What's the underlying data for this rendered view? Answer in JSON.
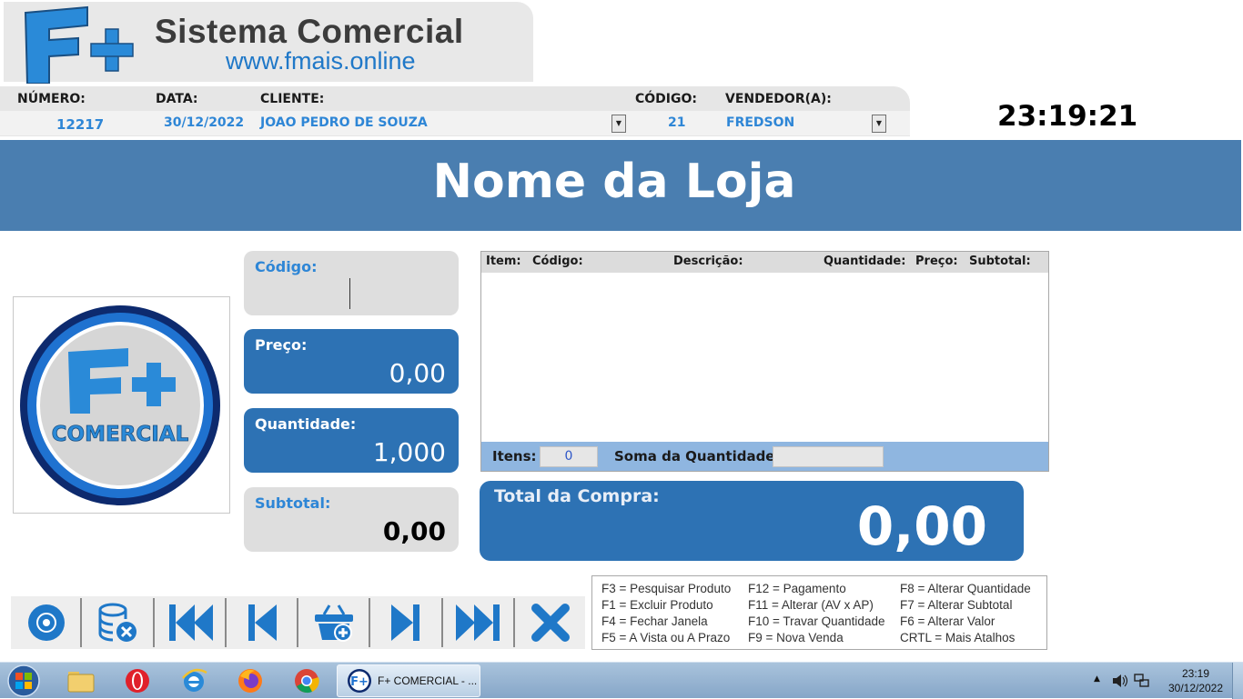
{
  "logo": {
    "title": "Sistema Comercial",
    "url": "www.fmais.online"
  },
  "header": {
    "numero_label": "NÚMERO:",
    "numero_value": "12217",
    "data_label": "DATA:",
    "data_value": "30/12/2022",
    "cliente_label": "CLIENTE:",
    "cliente_value": "JOAO PEDRO DE SOUZA",
    "codigo_label": "CÓDIGO:",
    "codigo_value": "21",
    "vendedor_label": "VENDEDOR(A):",
    "vendedor_value": "FREDSON",
    "clock": "23:19:21"
  },
  "banner": {
    "store_name": "Nome da Loja"
  },
  "circle_logo": {
    "text": "COMERCIAL"
  },
  "fields": {
    "codigo_label": "Código:",
    "codigo_value": "",
    "preco_label": "Preço:",
    "preco_value": "0,00",
    "quantidade_label": "Quantidade:",
    "quantidade_value": "1,000",
    "subtotal_label": "Subtotal:",
    "subtotal_value": "0,00"
  },
  "items_table": {
    "columns": [
      "Item:",
      "Código:",
      "Descrição:",
      "Quantidade:",
      "Preço:",
      "Subtotal:"
    ],
    "rows": [],
    "itens_label": "Itens:",
    "itens_value": "0",
    "soma_label": "Soma da Quantidade:",
    "soma_value": ""
  },
  "total": {
    "label": "Total da Compra:",
    "value": "0,00"
  },
  "toolbar": {
    "buttons": [
      "disc-icon",
      "database-delete-icon",
      "first-record-icon",
      "previous-record-icon",
      "basket-add-icon",
      "next-record-icon",
      "last-record-icon",
      "close-icon"
    ],
    "accent_color": "#1f78c8"
  },
  "shortcuts": [
    "F3 = Pesquisar Produto",
    "F12 = Pagamento",
    "F8 = Alterar Quantidade",
    "F1 = Excluir Produto",
    "F11 = Alterar (AV x AP)",
    "F7 = Alterar Subtotal",
    "F4 = Fechar Janela",
    "F10 = Travar Quantidade",
    "F6 = Alterar Valor",
    "F5 = A Vista ou A Prazo",
    "F9 = Nova Venda",
    "CRTL = Mais Atalhos"
  ],
  "taskbar": {
    "task_label": "F+ COMERCIAL - ...",
    "time": "23:19",
    "date": "30/12/2022"
  },
  "colors": {
    "banner": "#4a7eb0",
    "field_blue": "#2d72b4",
    "value_blue": "#2e86d6"
  }
}
